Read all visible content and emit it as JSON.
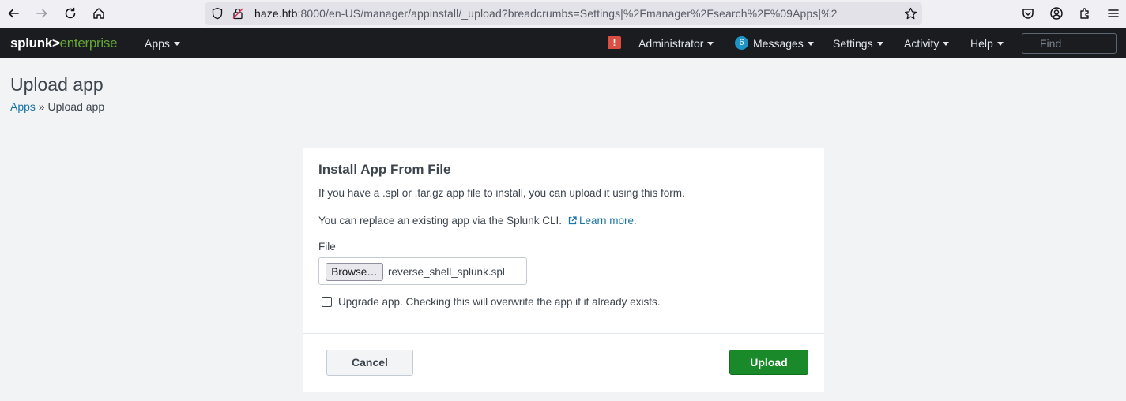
{
  "browser": {
    "url_host": "haze.htb",
    "url_rest": ":8000/en-US/manager/appinstall/_upload?breadcrumbs=Settings|%2Fmanager%2Fsearch%2F%09Apps|%2"
  },
  "splunk": {
    "logo_main": "splunk>",
    "logo_sub": "enterprise",
    "nav": {
      "apps": "Apps",
      "administrator": "Administrator",
      "messages_count": "6",
      "messages": "Messages",
      "settings": "Settings",
      "activity": "Activity",
      "help": "Help",
      "alert": "!",
      "find_placeholder": "Find"
    }
  },
  "page": {
    "title": "Upload app",
    "breadcrumb_link": "Apps",
    "breadcrumb_sep": " » ",
    "breadcrumb_current": "Upload app"
  },
  "panel": {
    "title": "Install App From File",
    "desc1": "If you have a .spl or .tar.gz app file to install, you can upload it using this form.",
    "desc2": "You can replace an existing app via the Splunk CLI.",
    "learn_more": "Learn more.",
    "file_label": "File",
    "browse": "Browse…",
    "file_name": "reverse_shell_splunk.spl",
    "upgrade_label": "Upgrade app. Checking this will overwrite the app if it already exists.",
    "upgrade_checked": false,
    "cancel": "Cancel",
    "upload": "Upload"
  },
  "colors": {
    "accent_green": "#1a8929",
    "link_blue": "#1a73a6",
    "alert_red": "#dc4e41",
    "badge_blue": "#1e93c6"
  }
}
